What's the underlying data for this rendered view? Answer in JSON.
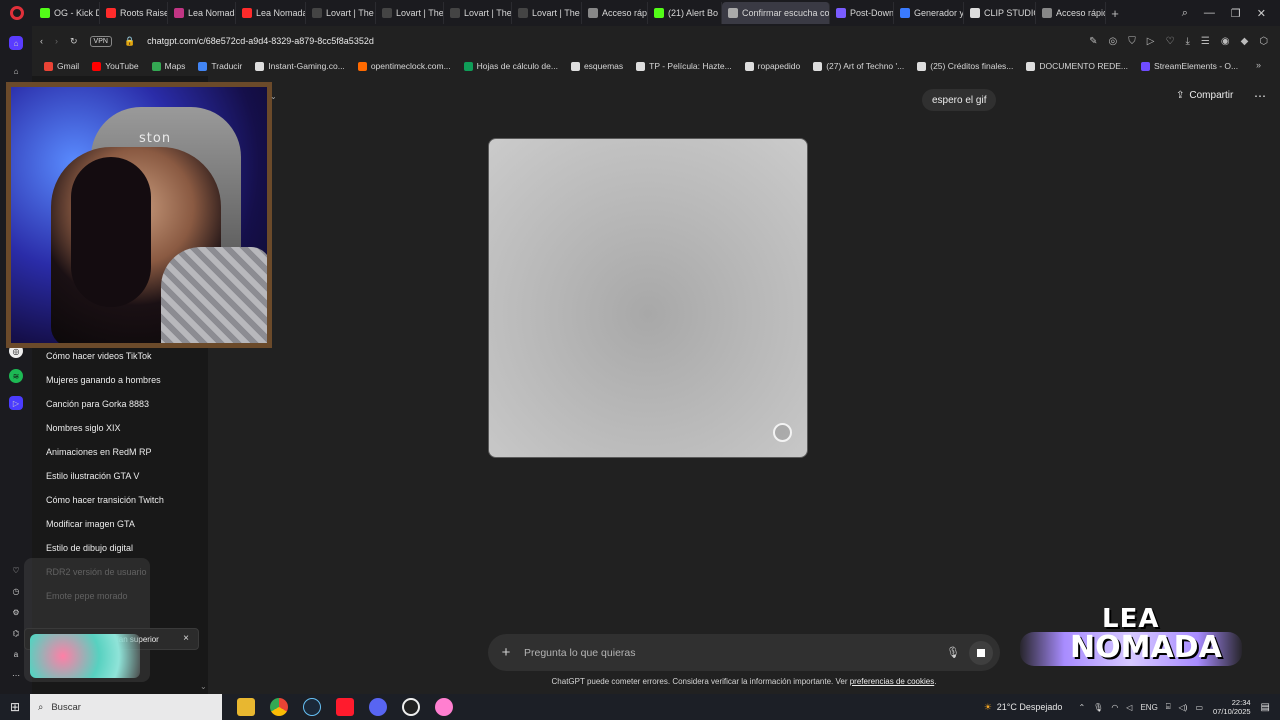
{
  "browser": {
    "tabs": [
      {
        "label": "OG - Kick Da",
        "color": "#53fc18"
      },
      {
        "label": "Roots Raisen",
        "color": "#ff2b2b"
      },
      {
        "label": "Lea Nomada",
        "color": "#c13584"
      },
      {
        "label": "Lea Nomada",
        "color": "#ff2b2b"
      },
      {
        "label": "Lovart | The V",
        "color": "#444444"
      },
      {
        "label": "Lovart | The V",
        "color": "#444444"
      },
      {
        "label": "Lovart | The V",
        "color": "#444444"
      },
      {
        "label": "Lovart | The V",
        "color": "#444444"
      },
      {
        "label": "Acceso rápido",
        "color": "#888888"
      },
      {
        "label": "(21) Alert Bo",
        "color": "#53fc18"
      },
      {
        "label": "Confirmar escucha con",
        "color": "#aaaaaa",
        "active": true
      },
      {
        "label": "Post-Downlo",
        "color": "#7a5cff"
      },
      {
        "label": "Generador y",
        "color": "#3a7bff"
      },
      {
        "label": "CLIP STUDIO",
        "color": "#dddddd"
      },
      {
        "label": "Acceso rápido",
        "color": "#888888"
      }
    ],
    "new_tab": "+",
    "vpn_badge": "VPN",
    "url": "chatgpt.com/c/68e572cd-a9d4-8329-a879-8cc5f8a5352d",
    "bookmarks": [
      {
        "label": "Gmail",
        "color": "#ea4335"
      },
      {
        "label": "YouTube",
        "color": "#ff0000"
      },
      {
        "label": "Maps",
        "color": "#34a853"
      },
      {
        "label": "Traducir",
        "color": "#4285f4"
      },
      {
        "label": "Instant-Gaming.co...",
        "color": "#dddddd"
      },
      {
        "label": "opentimeclock.com...",
        "color": "#ff6a00"
      },
      {
        "label": "Hojas de cálculo de...",
        "color": "#0f9d58"
      },
      {
        "label": "esquemas",
        "color": "#dddddd"
      },
      {
        "label": "TP - Película: Hazte...",
        "color": "#dddddd"
      },
      {
        "label": "ropapedido",
        "color": "#dddddd"
      },
      {
        "label": "(27) Art of Techno '...",
        "color": "#dddddd"
      },
      {
        "label": "(25) Créditos finales...",
        "color": "#dddddd"
      },
      {
        "label": "DOCUMENTO REDE...",
        "color": "#dddddd"
      },
      {
        "label": "StreamElements - O...",
        "color": "#6f4cff"
      }
    ]
  },
  "sidebar": {
    "chats": [
      {
        "label": "Cómo hacer videos TikTok"
      },
      {
        "label": "Mujeres ganando a hombres"
      },
      {
        "label": "Canción para Gorka 8883"
      },
      {
        "label": "Nombres siglo XIX"
      },
      {
        "label": "Animaciones en RedM RP"
      },
      {
        "label": "Estilo ilustración GTA V"
      },
      {
        "label": "Cómo hacer transición Twitch"
      },
      {
        "label": "Modificar imagen GTA"
      },
      {
        "label": "Estilo de dibujo digital"
      },
      {
        "label": "RDR2 versión de usuario"
      },
      {
        "label": "Emote pepe morado"
      }
    ],
    "toast": {
      "text": "Cambia a un plan superior",
      "close": "×"
    }
  },
  "header": {
    "share_label": "Compartir",
    "more_label": "⋯"
  },
  "conversation": {
    "user_message": "espero el gif"
  },
  "composer": {
    "plus": "+",
    "placeholder": "Pregunta lo que quieras",
    "disclaimer": "ChatGPT puede cometer errores. Considera verificar la información importante. Ver",
    "disclaimer_link": "preferencias de cookies",
    "disclaimer_end": "."
  },
  "overlay": {
    "chair_brand": "ston",
    "logo_line1": "LEA",
    "logo_line2": "NOMADA"
  },
  "taskbar": {
    "search_label": "Buscar",
    "weather": "21°C Despejado",
    "lang": "ENG",
    "time": "22:34",
    "date": "07/10/2025"
  }
}
